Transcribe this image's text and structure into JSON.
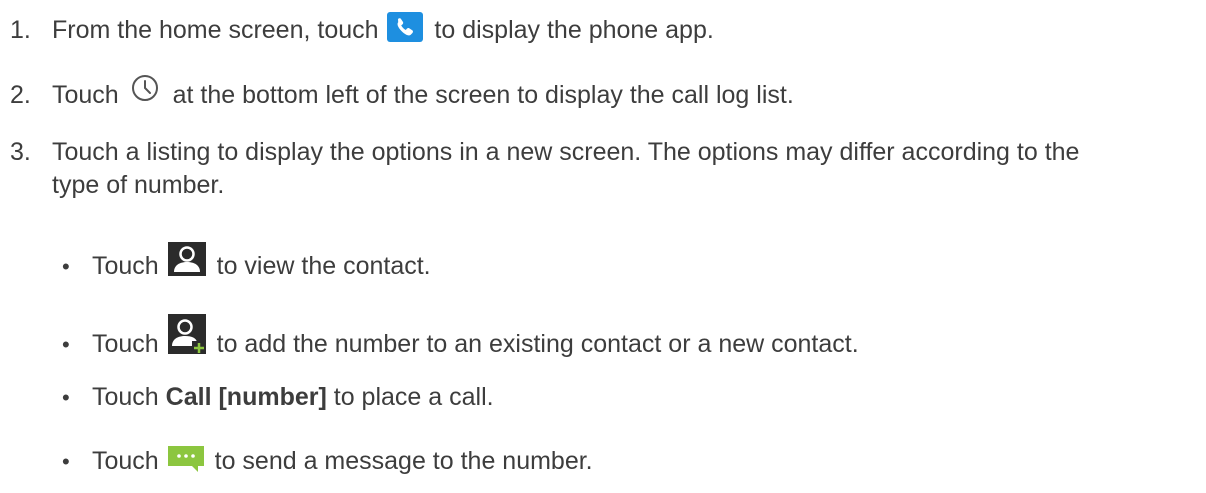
{
  "steps": [
    {
      "number": "1.",
      "before": "From the home screen, touch",
      "icon": "phone-app-icon",
      "after": "to display the phone app."
    },
    {
      "number": "2.",
      "before": "Touch",
      "icon": "call-log-clock-icon",
      "after": "at the bottom left of the screen to display the call log list."
    },
    {
      "number": "3.",
      "line1": "Touch a listing to display the options in a new screen. The options may differ according to the",
      "line2": "type of number."
    }
  ],
  "bullets": [
    {
      "before": "Touch",
      "icon": "view-contact-icon",
      "after": "to view the contact."
    },
    {
      "before": "Touch",
      "icon": "add-contact-icon",
      "after": "to add the number to an existing contact or a new contact."
    },
    {
      "before": "Touch",
      "bold": "Call [number]",
      "after": "to place a call."
    },
    {
      "before": "Touch",
      "icon": "message-icon",
      "after": "to send a message to the number."
    }
  ],
  "colors": {
    "text": "#3d3d3d",
    "phone_icon_bg": "#1e8fe0",
    "contact_icon_bg": "#2b2b2b",
    "message_icon_bg": "#8cc63f"
  }
}
